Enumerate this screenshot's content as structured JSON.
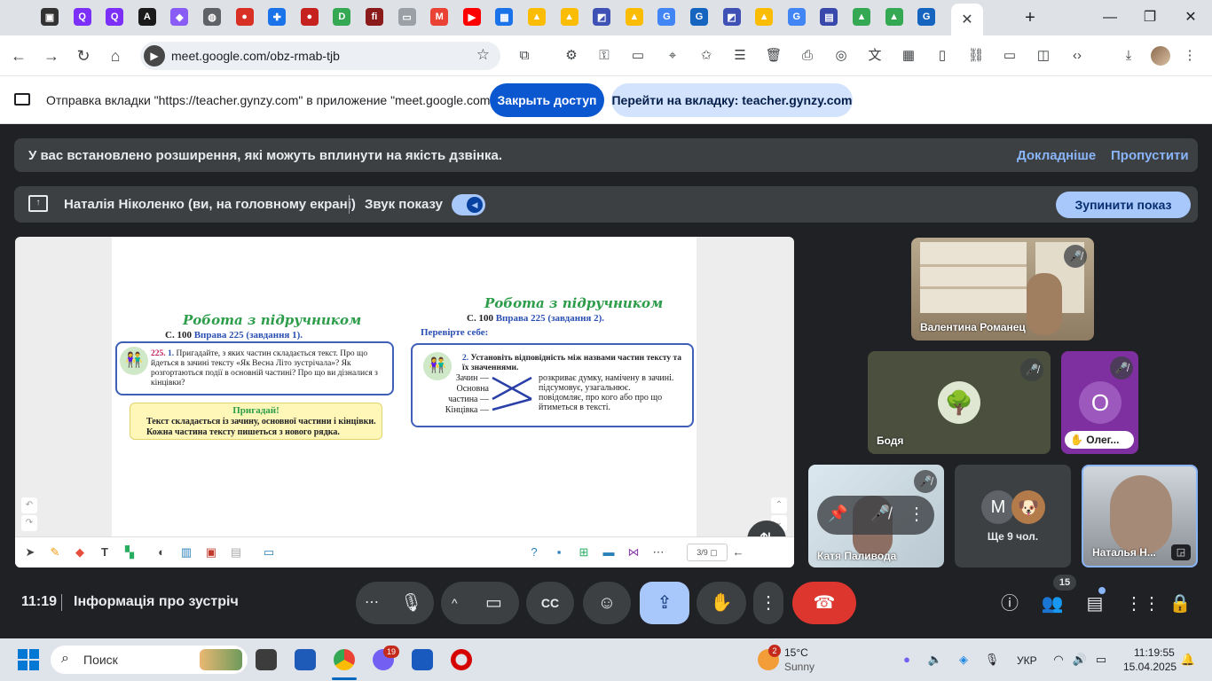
{
  "browser": {
    "url": "meet.google.com/obz-rmab-tjb",
    "tab_icons": [
      {
        "name": "app-icon",
        "color": "#333333",
        "glyph": "▣"
      },
      {
        "name": "quizlet-icon",
        "color": "#7b2ff7",
        "glyph": "Q"
      },
      {
        "name": "quizlet-icon",
        "color": "#7b2ff7",
        "glyph": "Q"
      },
      {
        "name": "adobe-icon",
        "color": "#1a1a1a",
        "glyph": "A"
      },
      {
        "name": "classroom-icon",
        "color": "#8a5cf6",
        "glyph": "◆"
      },
      {
        "name": "globe-icon",
        "color": "#5f6368",
        "glyph": "◍"
      },
      {
        "name": "red-dot-icon",
        "color": "#d93025",
        "glyph": "●"
      },
      {
        "name": "puzzle-icon",
        "color": "#1a73e8",
        "glyph": "✚"
      },
      {
        "name": "red-dot-icon",
        "color": "#c5221f",
        "glyph": "●"
      },
      {
        "name": "d-app-icon",
        "color": "#34a853",
        "glyph": "D"
      },
      {
        "name": "fi-icon",
        "color": "#8b1a1a",
        "glyph": "fi"
      },
      {
        "name": "board-icon",
        "color": "#9aa0a6",
        "glyph": "▭"
      },
      {
        "name": "gmail-icon",
        "color": "#ea4335",
        "glyph": "M"
      },
      {
        "name": "youtube-icon",
        "color": "#ff0000",
        "glyph": "▶"
      },
      {
        "name": "grid-app-icon",
        "color": "#1a73e8",
        "glyph": "▦"
      },
      {
        "name": "bell-icon",
        "color": "#fbbc04",
        "glyph": "▲"
      },
      {
        "name": "bell-icon",
        "color": "#fbbc04",
        "glyph": "▲"
      },
      {
        "name": "wordwall-icon",
        "color": "#3f51b5",
        "glyph": "◩"
      },
      {
        "name": "bell-icon",
        "color": "#fbbc04",
        "glyph": "▲"
      },
      {
        "name": "google-icon",
        "color": "#4285f4",
        "glyph": "G"
      },
      {
        "name": "gynzy-icon",
        "color": "#1565c0",
        "glyph": "G"
      },
      {
        "name": "wordwall-icon",
        "color": "#3f51b5",
        "glyph": "◩"
      },
      {
        "name": "bell-icon",
        "color": "#fbbc04",
        "glyph": "▲"
      },
      {
        "name": "google-icon",
        "color": "#4285f4",
        "glyph": "G"
      },
      {
        "name": "table-icon",
        "color": "#3949ab",
        "glyph": "▤"
      },
      {
        "name": "drive-icon",
        "color": "#34a853",
        "glyph": "▲"
      },
      {
        "name": "drive-icon",
        "color": "#34a853",
        "glyph": "▲"
      },
      {
        "name": "gynzy-icon",
        "color": "#1565c0",
        "glyph": "G"
      }
    ]
  },
  "infobar": {
    "text": "Отправка вкладки \"https://teacher.gynzy.com\" в приложение \"meet.google.com\"...",
    "stop_access": "Закрыть доступ",
    "go_to_tab": "Перейти на вкладку: teacher.gynzy.com"
  },
  "banner": {
    "text": "У вас встановлено розширення, які можуть вплинути на якість дзвінка.",
    "learn_more": "Докладніше",
    "skip": "Пропустити"
  },
  "presenting": {
    "text": "Наталія Ніколенко (ви, на головному екрані)",
    "sound_label": "Звук показу",
    "stop": "Зупинити показ"
  },
  "slide": {
    "left_title": "Робота з підручником",
    "left_sub_prefix": "С. 100",
    "left_sub_link": "Вправа 225 (завдання 1).",
    "ex_number": "225.",
    "ex_item": "1.",
    "ex_text": "Пригадайте, з яких частин складається текст. Про що йдеться в зачині тексту «Як Весна Літо зустрічала»? Як розгортаються події в основній частині? Про що ви дізналися з кінцівки?",
    "note_title": "Пригадай!",
    "note_text": "Текст складається із зачину, основної частини і кінцівки. Кожна частина тексту пишеться з нового рядка.",
    "right_title": "Робота з підручником",
    "right_sub_prefix": "С. 100",
    "right_sub_link": "Вправа 225 (завдання 2).",
    "check": "Перевірте себе:",
    "task_item": "2.",
    "task_text": "Установіть відповідність між назвами частин тексту та їх значеннями.",
    "left_terms": [
      "Зачин —",
      "Основна",
      "частина —",
      "Кінцівка —"
    ],
    "right_terms": [
      "розкриває думку, намічену в зачині.",
      "підсумовує, узагальнює.",
      "повідомляє, про кого або про що йтиметься в тексті."
    ],
    "page_counter": "3/9"
  },
  "participants": [
    {
      "name": "Валентина Романец"
    },
    {
      "name": "Бодя"
    },
    {
      "name": "Олег...",
      "initial": "О"
    },
    {
      "name": "Катя Паливода"
    },
    {
      "name": "Ще 9 чол.",
      "initial": "М"
    },
    {
      "name": "Наталья Н..."
    }
  ],
  "bottom": {
    "time": "11:19",
    "meeting_info": "Інформація про зустріч",
    "people_count": "15"
  },
  "taskbar": {
    "search": "Поиск",
    "mail_badge": "19",
    "weather_badge": "2",
    "temperature": "15°C",
    "weather": "Sunny",
    "language": "УКР",
    "clock_time": "11:19:55",
    "clock_date": "15.04.2025"
  }
}
